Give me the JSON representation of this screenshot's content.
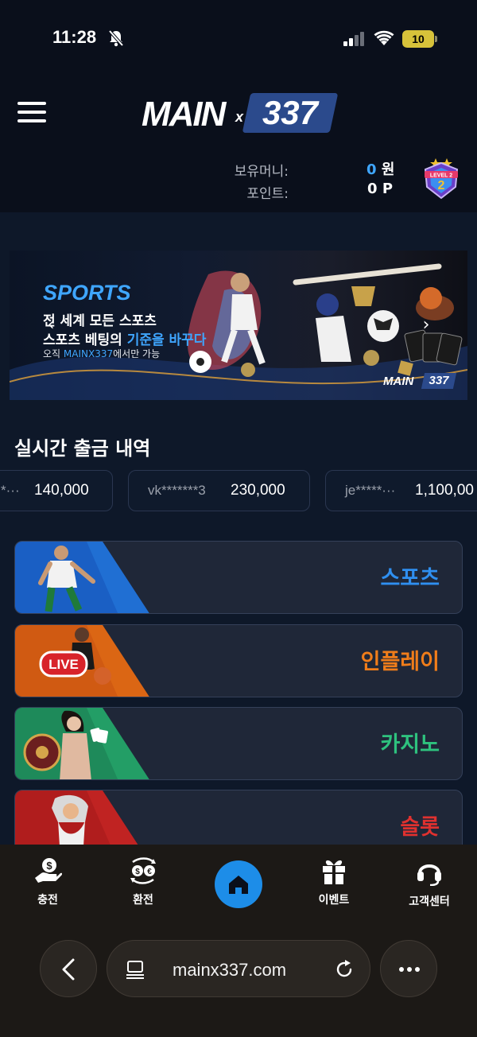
{
  "status_bar": {
    "time": "11:28",
    "battery": "10"
  },
  "header": {
    "logo_main": "MAIN",
    "logo_x": "x",
    "logo_num": "337",
    "balance_label": "보유머니:",
    "balance_value": "0",
    "balance_unit": "원",
    "points_label": "포인트:",
    "points_value": "0",
    "points_unit": "P",
    "level_badge": "LEVEL 2"
  },
  "banner": {
    "sports": "SPORTS",
    "line1": "전 세계 모든 스포츠",
    "line2_a": "스포츠 베팅의 ",
    "line2_b": "기준을 바꾸다",
    "line3_a": "오직 ",
    "line3_b": "MAINX337",
    "line3_c": "에서만 가능",
    "logo_main": "MAIN",
    "logo_num": "337",
    "prev_icon": "chevron-left-icon",
    "next_icon": "chevron-right-icon"
  },
  "withdrawals": {
    "title": "실시간 출금 내역",
    "items": [
      {
        "id": "*···",
        "amount": "140,000"
      },
      {
        "id": "vk*******3",
        "amount": "230,000"
      },
      {
        "id": "je*****···",
        "amount": "1,100,00"
      }
    ]
  },
  "games": [
    {
      "label": "스포츠",
      "color": "#2f8ff0",
      "accent": "#1a5fc4"
    },
    {
      "label": "인플레이",
      "color": "#f07d1a",
      "accent": "#d05a12"
    },
    {
      "label": "카지노",
      "color": "#2ec27e",
      "accent": "#1e8a5a"
    },
    {
      "label": "슬롯",
      "color": "#e0312f",
      "accent": "#b01d1d"
    }
  ],
  "live_badge": "LIVE",
  "bottom_nav": {
    "charge": "충전",
    "exchange": "환전",
    "event": "이벤트",
    "support": "고객센터"
  },
  "browser": {
    "url": "mainx337.com"
  }
}
